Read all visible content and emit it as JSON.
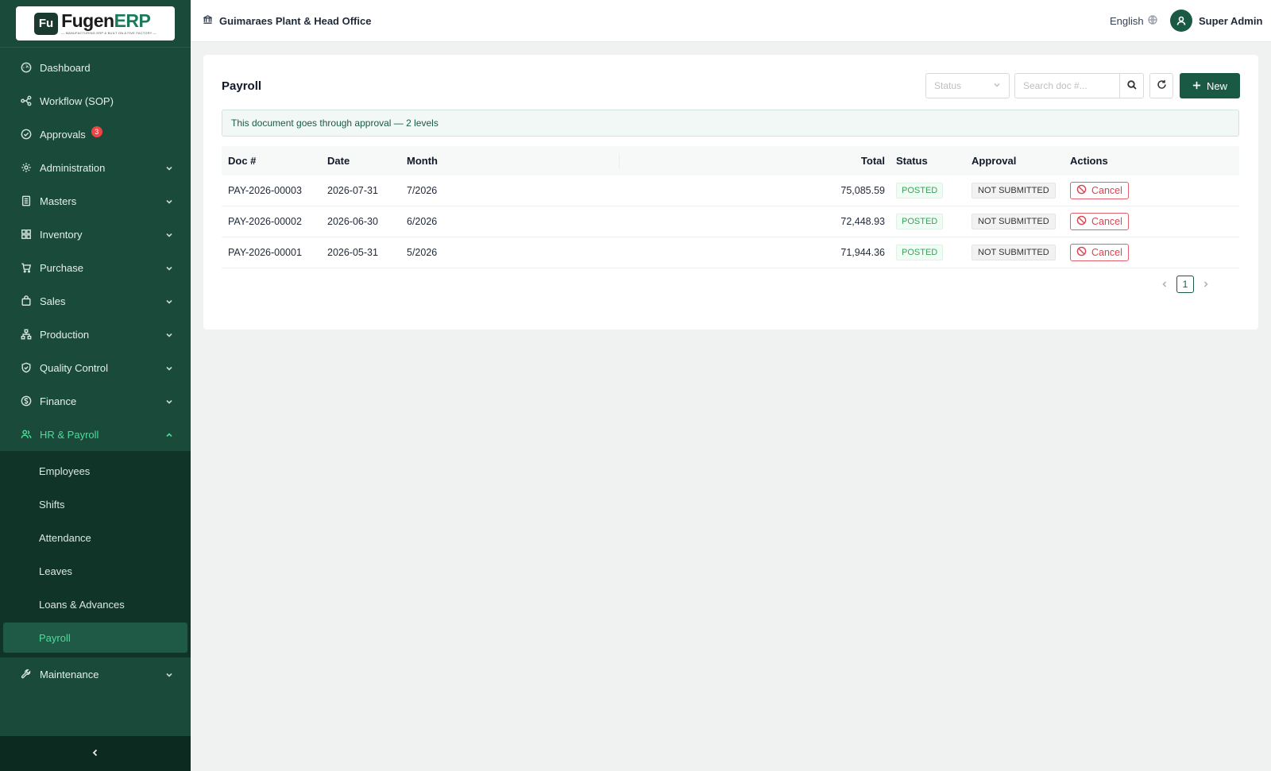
{
  "brand": {
    "mark": "Fu",
    "name_primary": "Fugen",
    "name_accent": "ERP",
    "tagline": "— MANUFACTURING ERP & BUILT ON A FIVE FACTORY —"
  },
  "sidebar": {
    "items": [
      {
        "label": "Dashboard",
        "icon": "dashboard-icon"
      },
      {
        "label": "Workflow (SOP)",
        "icon": "workflow-icon"
      },
      {
        "label": "Approvals",
        "icon": "check-circle-icon",
        "badge": "3"
      },
      {
        "label": "Administration",
        "icon": "gear-icon"
      },
      {
        "label": "Masters",
        "icon": "book-icon"
      },
      {
        "label": "Inventory",
        "icon": "grid-icon"
      },
      {
        "label": "Purchase",
        "icon": "cart-icon"
      },
      {
        "label": "Sales",
        "icon": "shopping-bag-icon"
      },
      {
        "label": "Production",
        "icon": "hierarchy-icon"
      },
      {
        "label": "Quality Control",
        "icon": "shield-icon"
      },
      {
        "label": "Finance",
        "icon": "dollar-icon"
      },
      {
        "label": "HR & Payroll",
        "icon": "users-icon"
      },
      {
        "label": "Maintenance",
        "icon": "wrench-icon"
      }
    ],
    "hr_sub": [
      "Employees",
      "Shifts",
      "Attendance",
      "Leaves",
      "Loans & Advances",
      "Payroll"
    ]
  },
  "header": {
    "org": "Guimaraes Plant & Head Office",
    "language": "English",
    "user": "Super Admin"
  },
  "page": {
    "title": "Payroll",
    "status_placeholder": "Status",
    "search_placeholder": "Search doc #...",
    "new_label": "New",
    "notice": "This document goes through approval — 2 levels"
  },
  "table": {
    "headers": {
      "doc": "Doc #",
      "date": "Date",
      "month": "Month",
      "total": "Total",
      "status": "Status",
      "approval": "Approval",
      "actions": "Actions"
    },
    "rows": [
      {
        "doc": "PAY-2026-00003",
        "date": "2026-07-31",
        "month": "7/2026",
        "total": "75,085.59",
        "status": "POSTED",
        "approval": "NOT SUBMITTED",
        "action": "Cancel"
      },
      {
        "doc": "PAY-2026-00002",
        "date": "2026-06-30",
        "month": "6/2026",
        "total": "72,448.93",
        "status": "POSTED",
        "approval": "NOT SUBMITTED",
        "action": "Cancel"
      },
      {
        "doc": "PAY-2026-00001",
        "date": "2026-05-31",
        "month": "5/2026",
        "total": "71,944.36",
        "status": "POSTED",
        "approval": "NOT SUBMITTED",
        "action": "Cancel"
      }
    ]
  },
  "pagination": {
    "current": "1"
  },
  "colors": {
    "sidebar": "#1a4a3a",
    "accent": "#1a5a45",
    "active_text": "#4ade9a",
    "danger": "#d94452"
  }
}
